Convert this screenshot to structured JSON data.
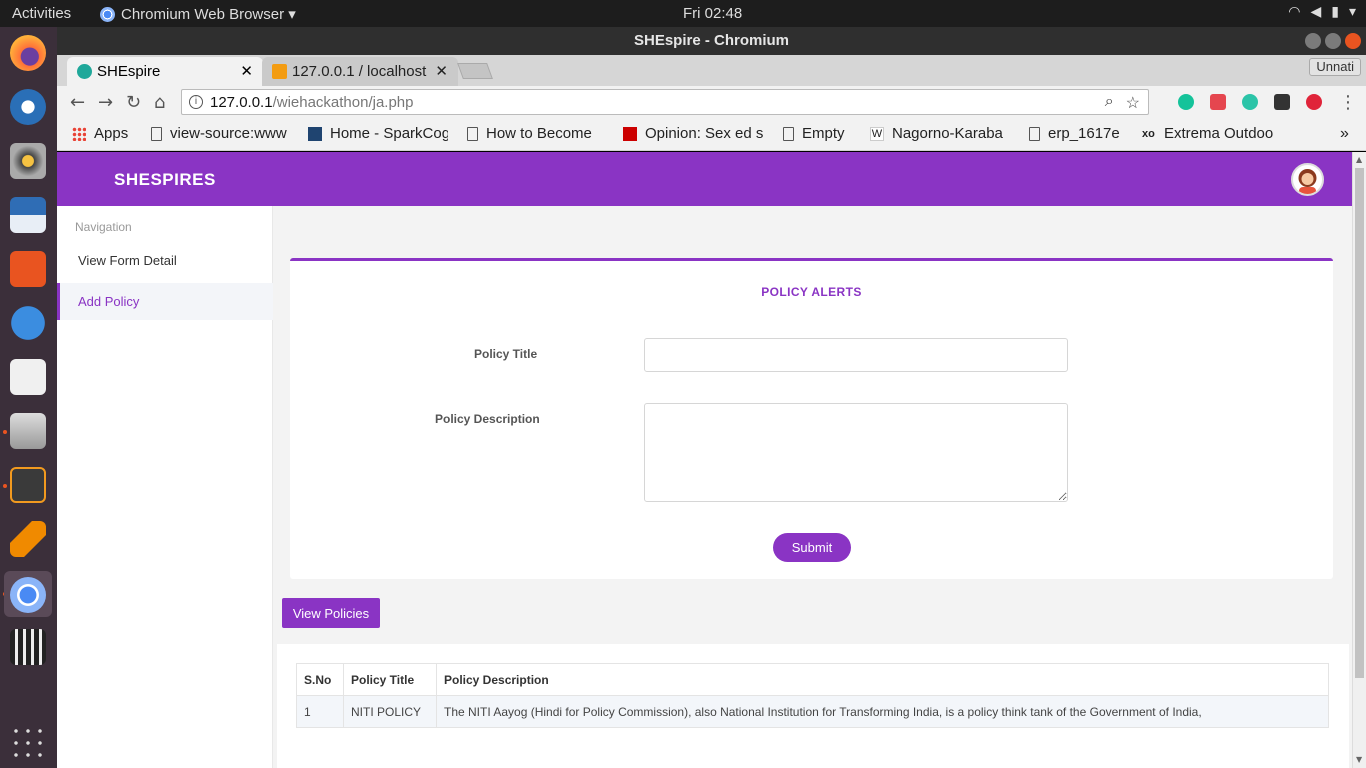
{
  "os": {
    "activities": "Activities",
    "app_menu": "Chromium Web Browser ▾",
    "clock": "Fri 02:48"
  },
  "window": {
    "title": "SHEspire - Chromium",
    "profile": "Unnati"
  },
  "tabs": [
    {
      "label": "SHEspire",
      "active": true,
      "favicon_color": "#1fa89a"
    },
    {
      "label": "127.0.0.1 / localhost",
      "active": false,
      "favicon_color": "#f39c12"
    }
  ],
  "address": {
    "host": "127.0.0.1",
    "path": "/wiehackathon/ja.php"
  },
  "bookmarks": [
    {
      "label": "Apps",
      "icon": "apps-grid-icon"
    },
    {
      "label": "view-source:www",
      "icon": "document-icon"
    },
    {
      "label": "Home - SparkCog",
      "icon": "sparkcog-icon"
    },
    {
      "label": "How to Become",
      "icon": "document-icon"
    },
    {
      "label": "Opinion: Sex ed s",
      "icon": "cnn-icon"
    },
    {
      "label": "Empty",
      "icon": "document-icon"
    },
    {
      "label": "Nagorno-Karaba",
      "icon": "wikipedia-icon"
    },
    {
      "label": "erp_1617e",
      "icon": "document-icon"
    },
    {
      "label": "Extrema Outdoo",
      "icon": "xo-icon"
    }
  ],
  "app": {
    "brand": "SHESPIRES",
    "nav_heading": "Navigation",
    "nav_items": [
      {
        "label": "View Form Detail",
        "active": false
      },
      {
        "label": "Add Policy",
        "active": true
      }
    ],
    "accent": "#8a34c4"
  },
  "form": {
    "title": "POLICY ALERTS",
    "policy_title_label": "Policy Title",
    "policy_title_value": "",
    "policy_desc_label": "Policy Description",
    "policy_desc_value": "",
    "submit_label": "Submit"
  },
  "view_policies_label": "View Policies",
  "table": {
    "columns": [
      "S.No",
      "Policy Title",
      "Policy Description"
    ],
    "rows": [
      [
        "1",
        "NITI POLICY",
        "The NITI Aayog (Hindi for Policy Commission), also National Institution for Transforming India, is a policy think tank of the Government of India,"
      ]
    ]
  }
}
